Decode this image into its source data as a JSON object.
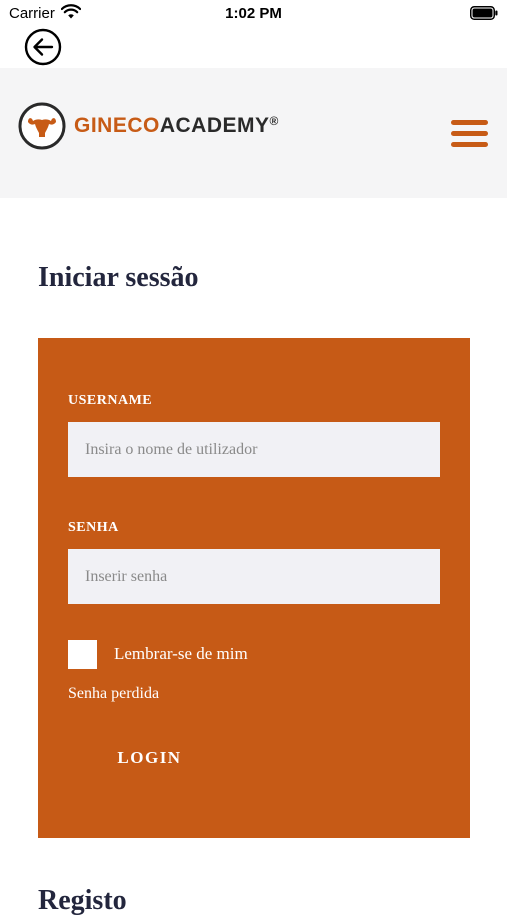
{
  "status_bar": {
    "carrier": "Carrier",
    "time": "1:02 PM",
    "wifi_icon": "wifi-icon",
    "battery_icon": "battery-icon"
  },
  "nav": {
    "back_icon": "arrow-left-circle-icon"
  },
  "header": {
    "brand_part1": "GINECO",
    "brand_part2": "ACADEMY",
    "brand_mark": "®",
    "logo_icon": "uterus-icon",
    "menu_icon": "hamburger-menu-icon",
    "accent_color": "#c75b16"
  },
  "page": {
    "title": "Iniciar sessão",
    "next_section_title": "Registo"
  },
  "login_form": {
    "background_color": "#c65a16",
    "username_label": "USERNAME",
    "username_placeholder": "Insira o nome de utilizador",
    "username_value": "",
    "password_label": "SENHA",
    "password_placeholder": "Inserir senha",
    "password_value": "",
    "remember_label": "Lembrar-se de mim",
    "remember_checked": false,
    "lost_password_link": "Senha perdida",
    "login_button": "LOGIN"
  }
}
